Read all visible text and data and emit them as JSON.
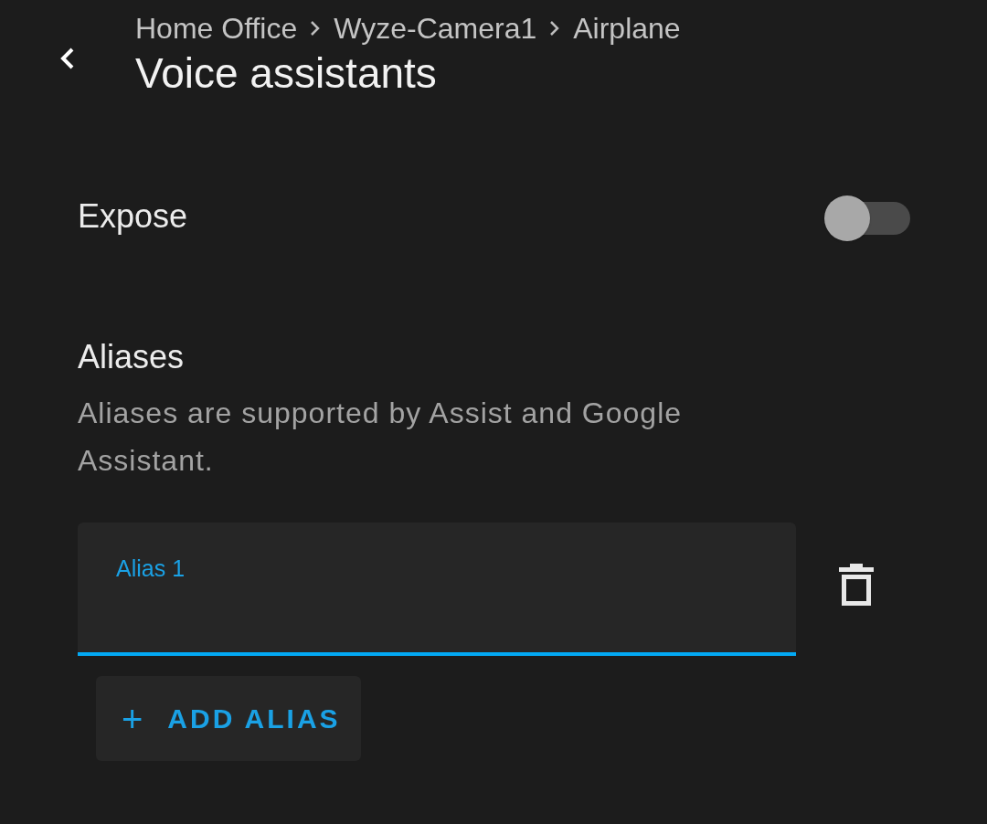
{
  "header": {
    "breadcrumb": [
      "Home Office",
      "Wyze-Camera1",
      "Airplane"
    ],
    "title": "Voice assistants"
  },
  "expose": {
    "label": "Expose",
    "on": false
  },
  "aliases": {
    "title": "Aliases",
    "description": "Aliases are supported by Assist and Google Assistant.",
    "fields": [
      {
        "label": "Alias 1",
        "focused": true
      }
    ],
    "add_button": {
      "icon": "+",
      "label": "ADD ALIAS"
    }
  }
}
